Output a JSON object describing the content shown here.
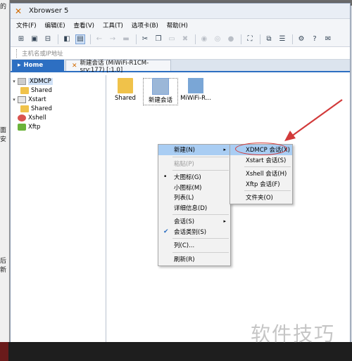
{
  "window": {
    "title": "Xbrowser 5"
  },
  "background": {
    "left_fragments": [
      "的",
      "面安",
      "后新"
    ]
  },
  "menubar": {
    "items": [
      "文件(F)",
      "编辑(E)",
      "查看(V)",
      "工具(T)",
      "选项卡(B)",
      "帮助(H)"
    ]
  },
  "addressbar": {
    "placeholder": "主机名或IP地址"
  },
  "tabs": {
    "home": "Home",
    "session": "新建会话 (MiWiFi-R1CM-srv:177) [:1.0]"
  },
  "tree": {
    "items": [
      {
        "label": "XDMCP"
      },
      {
        "label": "Shared"
      },
      {
        "label": "Xstart"
      },
      {
        "label": "Shared"
      },
      {
        "label": "Xshell"
      },
      {
        "label": "Xftp"
      }
    ]
  },
  "content": {
    "items": [
      "Shared",
      "新建会话",
      "MiWiFi-R..."
    ]
  },
  "context_menu": {
    "items": {
      "new": "新建(N)",
      "paste": "粘贴(P)",
      "large_icons": "大图标(G)",
      "small_icons": "小图标(M)",
      "list": "列表(L)",
      "details": "详细信息(D)",
      "sessions": "会话(S)",
      "session_category": "会话类别(S)",
      "columns": "列(C)...",
      "refresh": "刷新(R)"
    }
  },
  "submenu": {
    "items": {
      "xdmcp": "XDMCP 会话(X)",
      "xstart": "Xstart 会话(S)",
      "xshell": "Xshell 会话(H)",
      "xftp": "Xftp 会话(F)",
      "folder": "文件夹(O)"
    }
  },
  "watermark": "软件技巧",
  "colors": {
    "accent": "#2d6fc2",
    "highlight": "#a9cdf3",
    "annotation": "#d23a3a"
  }
}
